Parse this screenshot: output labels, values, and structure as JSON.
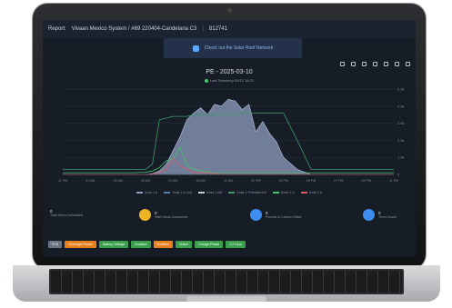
{
  "header": {
    "report_label": "Report:",
    "system_name": "Vivaan Mexico System / #69 220404-Candelaria C3",
    "system_id": "812741"
  },
  "banner": {
    "text": "Check out the Solar Roof Network"
  },
  "chart_data": {
    "type": "area",
    "title": "PE - 2025-03-10",
    "subtitle": "Last Telemetry 03/12 18:21",
    "x_ticks": [
      "11 PM",
      "01 AM",
      "03 AM",
      "05 AM",
      "07 AM",
      "09 AM",
      "11 AM",
      "01 PM",
      "03 PM",
      "05 PM",
      "07 PM",
      "09 PM",
      "11 PM"
    ],
    "y_right_ticks": [
      "0",
      "1.0k",
      "2.0k",
      "3.0k",
      "4.0k",
      "5.0k"
    ],
    "x": [
      0,
      1,
      2,
      3,
      4,
      5,
      6,
      6.5,
      7,
      7.5,
      8,
      8.5,
      9,
      9.5,
      10,
      10.5,
      11,
      11.5,
      12,
      12.5,
      13,
      13.5,
      14,
      14.5,
      15,
      15.5,
      16,
      17,
      18,
      19,
      20,
      21,
      22,
      23,
      24
    ],
    "series": [
      {
        "name": "Solar 1 A",
        "color": "#8f9fc2",
        "values": [
          0,
          0,
          0,
          0,
          0,
          0,
          0,
          0.05,
          0.2,
          0.6,
          1.4,
          2.2,
          3.2,
          3.6,
          3.9,
          3.5,
          4.1,
          4.0,
          4.4,
          4.3,
          3.8,
          4.1,
          2.5,
          3.1,
          2.4,
          1.9,
          1.0,
          0.3,
          0,
          0,
          0,
          0,
          0,
          0,
          0
        ]
      },
      {
        "name": "Solar 1 Pwr",
        "color": "#46c06a",
        "values": [
          0.1,
          0.1,
          0.1,
          0.1,
          0.1,
          0.1,
          0.12,
          0.2,
          0.4,
          0.8,
          0.9,
          1.6,
          0.5,
          0.3,
          0.2,
          0.15,
          0.1,
          0.1,
          0.1,
          0.1,
          0.1,
          0.1,
          0.1,
          0.1,
          0.1,
          0.1,
          0.1,
          0.1,
          0.1,
          0.1,
          0.1,
          0.1,
          0.1,
          0.1,
          0.1
        ]
      },
      {
        "name": "Solar 1 Potential",
        "color": "#3e9a68",
        "values": [
          0.3,
          0.3,
          0.3,
          0.3,
          0.3,
          0.3,
          0.3,
          0.6,
          3.2,
          3.3,
          3.4,
          3.4,
          3.4,
          3.5,
          3.5,
          3.5,
          3.5,
          3.5,
          3.5,
          3.5,
          3.6,
          3.6,
          3.6,
          3.6,
          3.6,
          3.6,
          3.6,
          2.0,
          0.3,
          0.3,
          0.3,
          0.3,
          0.3,
          0.3,
          0.3
        ]
      },
      {
        "name": "Solar 2 A",
        "color": "#e25563",
        "values": [
          0,
          0,
          0,
          0,
          0,
          0,
          0,
          0,
          0.1,
          0.3,
          0.9,
          0.5,
          0.3,
          0.1,
          0.1,
          0.1,
          0.05,
          0,
          0,
          0,
          0,
          0,
          0,
          0,
          0,
          0,
          0,
          0,
          0,
          0,
          0,
          0,
          0,
          0,
          0
        ]
      }
    ],
    "legend": [
      {
        "label": "Solar 1 A",
        "color": "#8f9fc2"
      },
      {
        "label": "Solar 1 A Volt",
        "color": "#5f7aa8"
      },
      {
        "label": "Solar 1 kW",
        "color": "#c7cdd8"
      },
      {
        "label": "Solar 1 Potential kW",
        "color": "#3e9a68"
      },
      {
        "label": "Solar 2 V",
        "color": "#46c06a"
      },
      {
        "label": "Solar 2 A",
        "color": "#e25563"
      }
    ],
    "ylim": [
      0,
      5
    ]
  },
  "stats": [
    {
      "value": "0",
      "label": "Total Hours Generated",
      "color": "#1f2a3a"
    },
    {
      "value": "0",
      "label": "Watt Hours Consumed",
      "color": "#f0b323"
    },
    {
      "value": "0",
      "label": "Pounds of Carbon Offset",
      "color": "#3d8df0"
    },
    {
      "value": "0",
      "label": "Trees Saved",
      "color": "#3d8df0"
    }
  ],
  "status_pills": [
    {
      "label": "SYS",
      "color": "#6a7484"
    },
    {
      "label": "Overnight Power",
      "color": "#e8801e"
    },
    {
      "label": "Battery Voltage",
      "color": "#3aa04b"
    },
    {
      "label": "Enabled",
      "color": "#3aa04b"
    },
    {
      "label": "Enabled",
      "color": "#e8801e"
    },
    {
      "label": "Online",
      "color": "#3aa04b"
    },
    {
      "label": "Charge Phase",
      "color": "#3aa04b"
    },
    {
      "label": "1.2 Hour",
      "color": "#3aa04b"
    }
  ]
}
